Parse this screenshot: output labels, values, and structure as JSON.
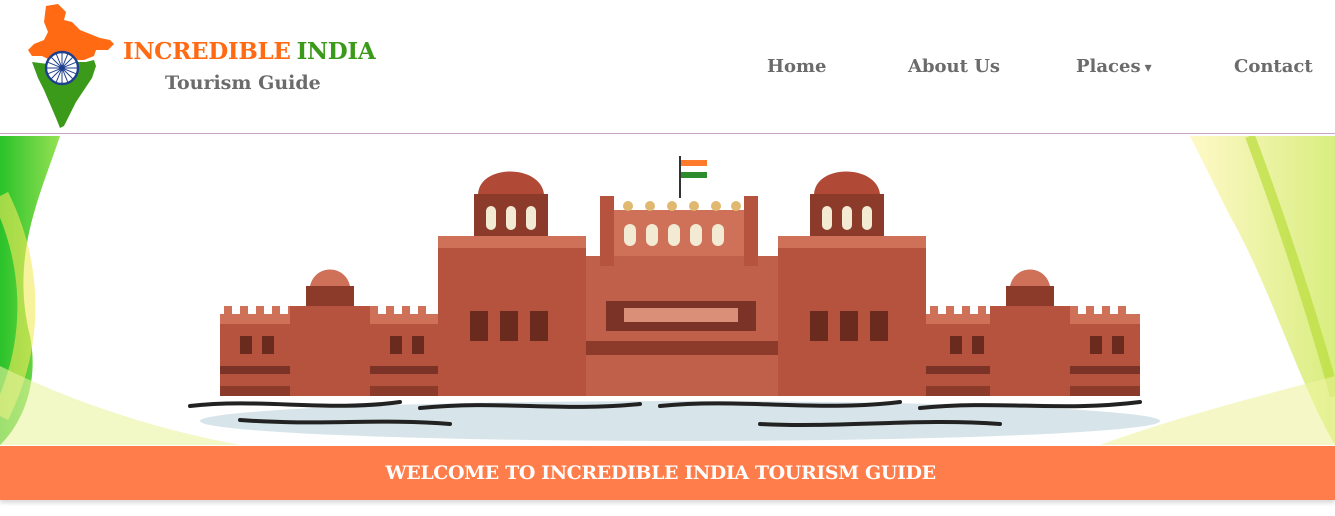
{
  "brand": {
    "title_part1": "INCREDIBLE",
    "title_part2": "INDIA",
    "subtitle": "Tourism Guide",
    "colors": {
      "saffron": "#ff6a13",
      "green": "#3c9a1a",
      "grey": "#6b6b6b"
    }
  },
  "nav": {
    "items": [
      {
        "label": "Home"
      },
      {
        "label": "About Us"
      },
      {
        "label": "Places",
        "caret": "▾"
      },
      {
        "label": "Contact"
      }
    ]
  },
  "hero": {
    "image": "red-fort-illustration"
  },
  "welcome": {
    "text": "WELCOME TO INCREDIBLE INDIA TOURISM GUIDE",
    "color": "#ff7d4a"
  }
}
